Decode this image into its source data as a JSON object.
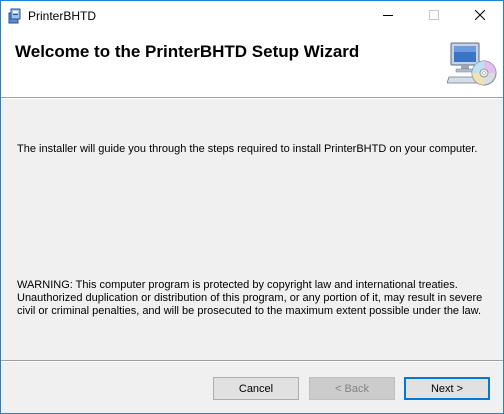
{
  "window": {
    "title": "PrinterBHTD",
    "app_icon": "installer-icon",
    "controls": {
      "minimize": "minimize-icon",
      "maximize": "maximize-icon",
      "close": "close-icon"
    }
  },
  "header": {
    "title": "Welcome to the PrinterBHTD Setup Wizard",
    "icon": "computer-cd-icon"
  },
  "body": {
    "intro": "The installer will guide you through the steps required to install PrinterBHTD on your computer.",
    "warning": "WARNING: This computer program is protected by copyright law and international treaties. Unauthorized duplication or distribution of this program, or any portion of it, may result in severe civil or criminal penalties, and will be prosecuted to the maximum extent possible under the law."
  },
  "buttons": {
    "cancel": "Cancel",
    "back": "< Back",
    "next": "Next >",
    "back_enabled": false
  },
  "colors": {
    "window_border": "#1883d7",
    "focus_border": "#0078d7",
    "desktop": "#3b78c4"
  }
}
